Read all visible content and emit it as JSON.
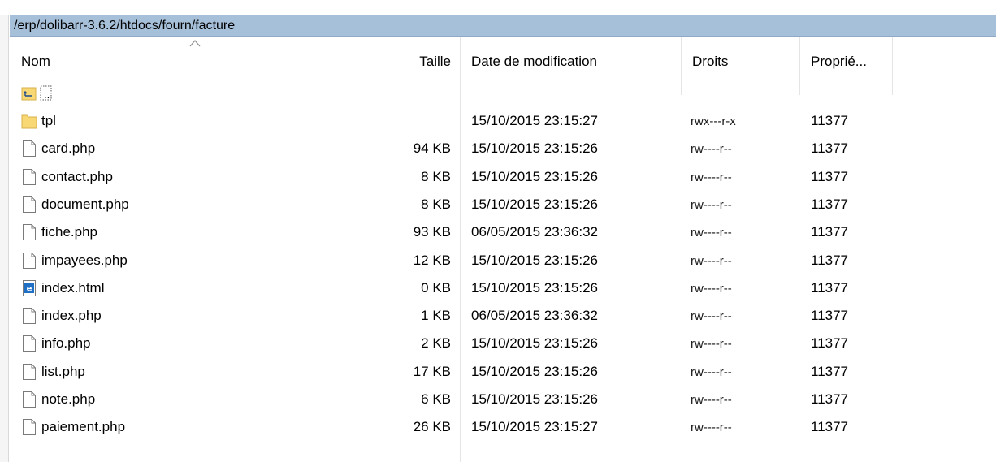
{
  "window": {
    "path": "/erp/dolibarr-3.6.2/htdocs/fourn/facture"
  },
  "columns": {
    "name": "Nom",
    "size": "Taille",
    "date": "Date de modification",
    "perms": "Droits",
    "owner": "Proprié..."
  },
  "parent_dir_label": "..",
  "rows": [
    {
      "name": "tpl",
      "size": "",
      "date": "15/10/2015 23:15:27",
      "perms": "rwx---r-x",
      "owner": "11377",
      "icon": "folder-icon"
    },
    {
      "name": "card.php",
      "size": "94 KB",
      "date": "15/10/2015 23:15:26",
      "perms": "rw----r--",
      "owner": "11377",
      "icon": "file-icon"
    },
    {
      "name": "contact.php",
      "size": "8 KB",
      "date": "15/10/2015 23:15:26",
      "perms": "rw----r--",
      "owner": "11377",
      "icon": "file-icon"
    },
    {
      "name": "document.php",
      "size": "8 KB",
      "date": "15/10/2015 23:15:26",
      "perms": "rw----r--",
      "owner": "11377",
      "icon": "file-icon"
    },
    {
      "name": "fiche.php",
      "size": "93 KB",
      "date": "06/05/2015 23:36:32",
      "perms": "rw----r--",
      "owner": "11377",
      "icon": "file-icon"
    },
    {
      "name": "impayees.php",
      "size": "12 KB",
      "date": "15/10/2015 23:15:26",
      "perms": "rw----r--",
      "owner": "11377",
      "icon": "file-icon"
    },
    {
      "name": "index.html",
      "size": "0 KB",
      "date": "15/10/2015 23:15:26",
      "perms": "rw----r--",
      "owner": "11377",
      "icon": "html-file-icon"
    },
    {
      "name": "index.php",
      "size": "1 KB",
      "date": "06/05/2015 23:36:32",
      "perms": "rw----r--",
      "owner": "11377",
      "icon": "file-icon"
    },
    {
      "name": "info.php",
      "size": "2 KB",
      "date": "15/10/2015 23:15:26",
      "perms": "rw----r--",
      "owner": "11377",
      "icon": "file-icon"
    },
    {
      "name": "list.php",
      "size": "17 KB",
      "date": "15/10/2015 23:15:26",
      "perms": "rw----r--",
      "owner": "11377",
      "icon": "file-icon"
    },
    {
      "name": "note.php",
      "size": "6 KB",
      "date": "15/10/2015 23:15:26",
      "perms": "rw----r--",
      "owner": "11377",
      "icon": "file-icon"
    },
    {
      "name": "paiement.php",
      "size": "26 KB",
      "date": "15/10/2015 23:15:27",
      "perms": "rw----r--",
      "owner": "11377",
      "icon": "file-icon"
    }
  ],
  "colors": {
    "path_bar": "#a7c0d9",
    "folder": "#f8d775",
    "html_icon": "#1f6fc5"
  }
}
